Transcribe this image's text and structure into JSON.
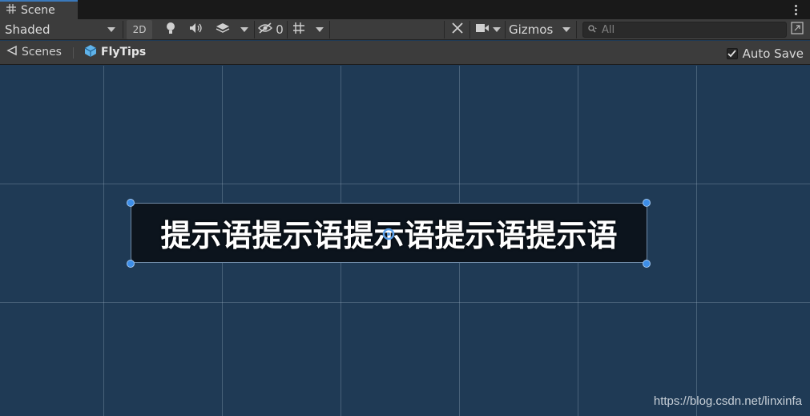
{
  "tab": {
    "title": "Scene",
    "icon": "grid-icon"
  },
  "toolbar": {
    "shading_mode": "Shaded",
    "mode_2d": "2D",
    "hidden_count": "0",
    "gizmos": "Gizmos",
    "search_placeholder": "All"
  },
  "breadcrumb": {
    "root": "Scenes",
    "current": "FlyTips"
  },
  "autosave": {
    "label": "Auto Save",
    "checked": true
  },
  "scene": {
    "tips_text": "提示语提示语提示语提示语提示语",
    "watermark": "https://blog.csdn.net/linxinfa"
  },
  "colors": {
    "scene_bg": "#1f3a55",
    "accent": "#3a79bb",
    "handle": "#3d8ee8"
  }
}
